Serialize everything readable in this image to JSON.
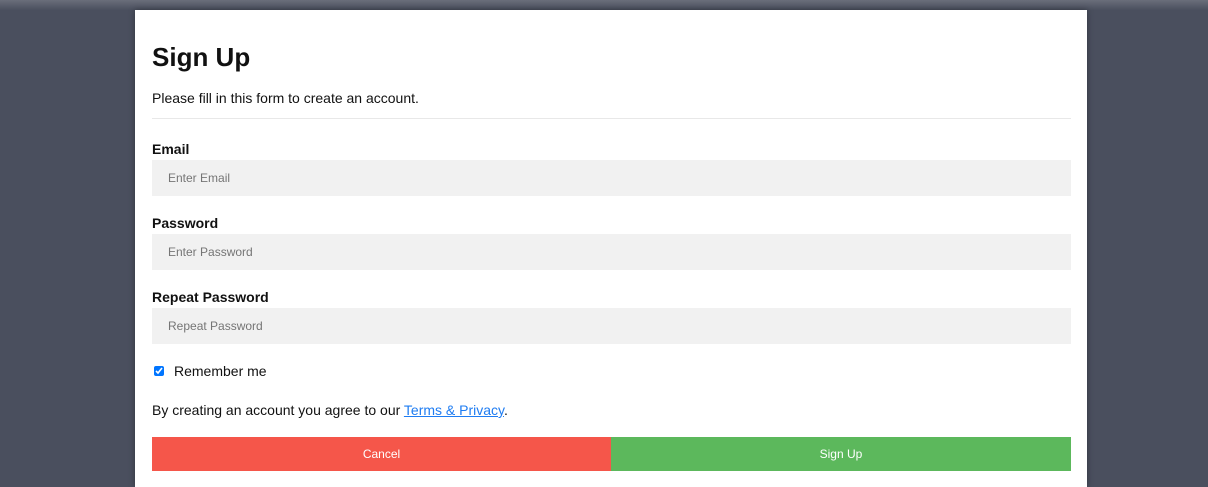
{
  "form": {
    "title": "Sign Up",
    "subtitle": "Please fill in this form to create an account.",
    "fields": [
      {
        "label": "Email",
        "placeholder": "Enter Email",
        "value": ""
      },
      {
        "label": "Password",
        "placeholder": "Enter Password",
        "value": ""
      },
      {
        "label": "Repeat Password",
        "placeholder": "Repeat Password",
        "value": ""
      }
    ],
    "remember": {
      "label": "Remember me",
      "checked": true
    },
    "agreement": {
      "prefix": "By creating an account you agree to our ",
      "link": "Terms & Privacy",
      "suffix": "."
    },
    "buttons": {
      "cancel": "Cancel",
      "signup": "Sign Up"
    }
  },
  "colors": {
    "backdrop": "#4a4f5e",
    "cancel": "#f5564a",
    "signup": "#5cb85c",
    "link": "#1e7cf2",
    "input_bg": "#f1f1f1"
  }
}
